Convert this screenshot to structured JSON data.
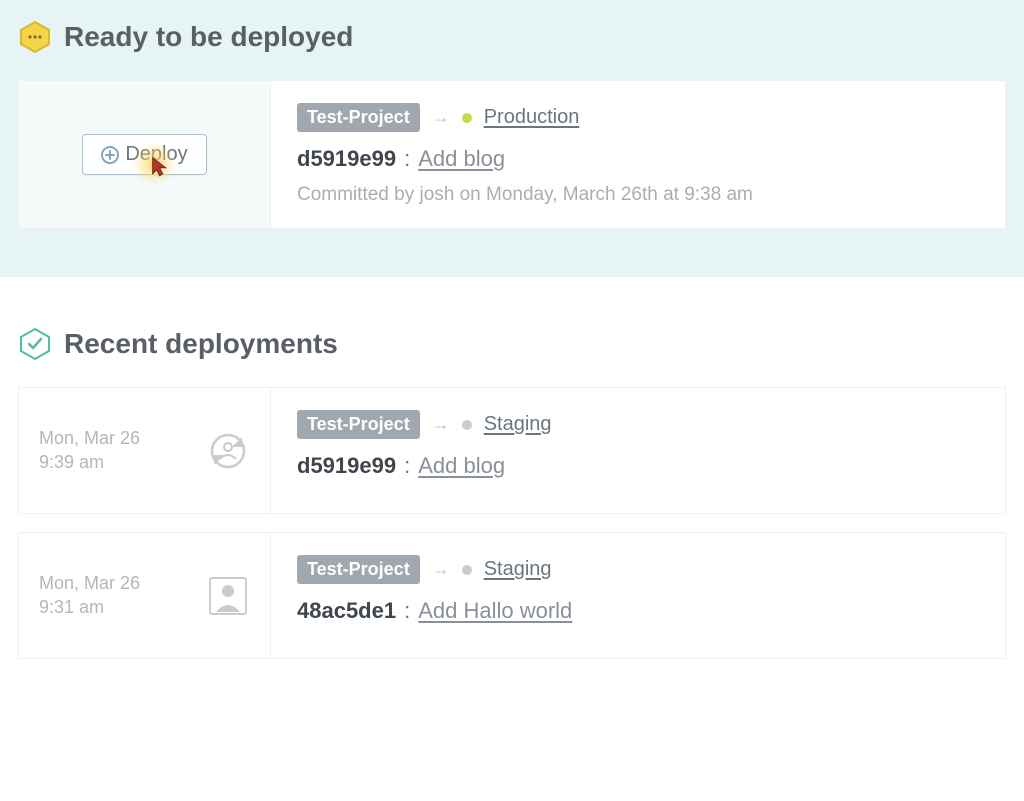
{
  "ready": {
    "title": "Ready to be deployed",
    "deploy_label": "Deploy",
    "card": {
      "project": "Test-Project",
      "environment": "Production",
      "env_color": "green",
      "commit_hash": "d5919e99",
      "commit_msg": "Add blog",
      "meta": "Committed by josh on Monday, March 26th at 9:38 am"
    }
  },
  "recent": {
    "title": "Recent deployments",
    "items": [
      {
        "date_line1": "Mon, Mar 26",
        "date_line2": "9:39 am",
        "avatar": "refresh",
        "project": "Test-Project",
        "environment": "Staging",
        "env_color": "grey",
        "commit_hash": "d5919e99",
        "commit_msg": "Add blog"
      },
      {
        "date_line1": "Mon, Mar 26",
        "date_line2": "9:31 am",
        "avatar": "anon",
        "project": "Test-Project",
        "environment": "Staging",
        "env_color": "grey",
        "commit_hash": "48ac5de1",
        "commit_msg": "Add Hallo world"
      }
    ]
  }
}
